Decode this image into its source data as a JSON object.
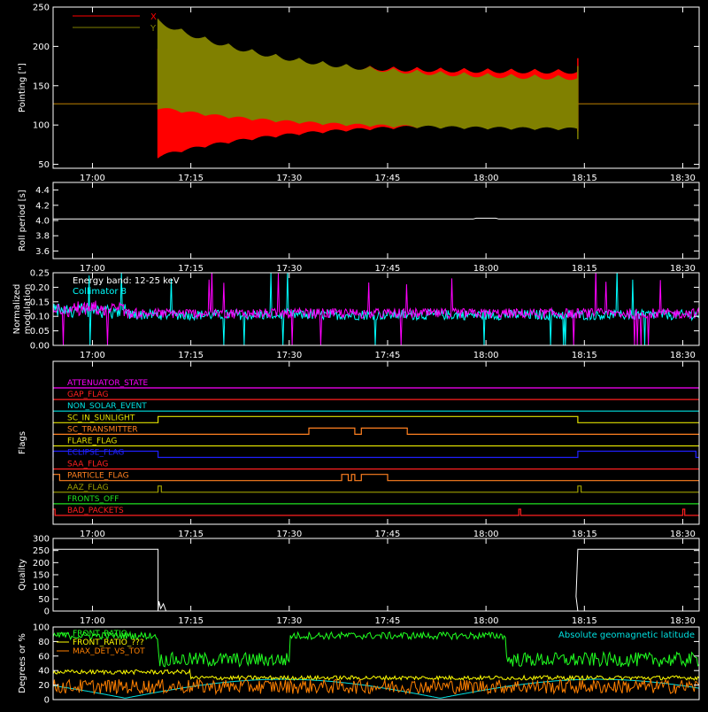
{
  "chart_data": [
    {
      "type": "line",
      "ylabel": "Pointing [\"]",
      "ylim": [
        45,
        250
      ],
      "yticks": [
        50,
        100,
        150,
        200,
        250
      ],
      "xticks": [
        "17:00",
        "17:15",
        "17:30",
        "17:45",
        "18:00",
        "18:15",
        "18:30"
      ],
      "legend_placement": "top-left",
      "series": [
        {
          "name": "X",
          "color": "#ff0000",
          "baseline": 127,
          "active_span": [
            "17:10",
            "18:14"
          ],
          "envelope_start": [
            58,
            197
          ],
          "envelope_end": [
            102,
            170
          ]
        },
        {
          "name": "Y",
          "color": "#808000",
          "baseline": 127,
          "active_span": [
            "17:10",
            "18:14"
          ],
          "envelope_start": [
            120,
            235
          ],
          "envelope_end": [
            92,
            160
          ]
        }
      ]
    },
    {
      "type": "line",
      "ylabel": "Roll period [s]",
      "ylim": [
        3.5,
        4.5
      ],
      "yticks": [
        "3.6",
        "3.8",
        "4.0",
        "4.2",
        "4.4"
      ],
      "xticks": [
        "17:00",
        "17:15",
        "17:30",
        "17:45",
        "18:00",
        "18:15",
        "18:30"
      ],
      "series": [
        {
          "color": "#ffffff",
          "value": 4.02
        }
      ]
    },
    {
      "type": "line",
      "ylabel": "Normalized\nmodulation",
      "ylim": [
        0,
        0.25
      ],
      "yticks": [
        "0.00",
        "0.05",
        "0.10",
        "0.15",
        "0.20",
        "0.25"
      ],
      "xticks": [
        "17:00",
        "17:15",
        "17:30",
        "17:45",
        "18:00",
        "18:15",
        "18:30"
      ],
      "annotations": [
        "Energy band: 12-25 keV",
        "Collimator 8"
      ],
      "series": [
        {
          "color": "#00ffff",
          "mean": 0.105
        },
        {
          "color": "#ff00ff",
          "mean": 0.11
        }
      ]
    },
    {
      "type": "line",
      "ylabel": "Flags",
      "xticks": [
        "17:00",
        "17:15",
        "17:30",
        "17:45",
        "18:00",
        "18:15",
        "18:30"
      ],
      "flags": [
        {
          "name": "ATTENUATOR_STATE",
          "color": "#ff00ff",
          "high": []
        },
        {
          "name": "GAP_FLAG",
          "color": "#ff2020",
          "high": []
        },
        {
          "name": "NON_SOLAR_EVENT",
          "color": "#00e0e0",
          "high": []
        },
        {
          "name": "SC_IN_SUNLIGHT",
          "color": "#e0e000",
          "high": [
            [
              "17:10",
              "18:14"
            ]
          ]
        },
        {
          "name": "SC_TRANSMITTER",
          "color": "#ff8020",
          "high": [
            [
              "17:33",
              "17:40"
            ],
            [
              "17:41",
              "17:48"
            ]
          ]
        },
        {
          "name": "FLARE_FLAG",
          "color": "#e0e000",
          "high": []
        },
        {
          "name": "ECLIPSE_FLAG",
          "color": "#2020ff",
          "high": [
            [
              "16:54",
              "17:10"
            ],
            [
              "18:14",
              "18:32"
            ]
          ]
        },
        {
          "name": "SAA_FLAG",
          "color": "#ff2020",
          "high": []
        },
        {
          "name": "PARTICLE_FLAG",
          "color": "#ff8020",
          "high": [
            [
              "16:54",
              "16:55"
            ],
            [
              "17:38",
              "17:39"
            ],
            [
              "17:39.5",
              "17:40"
            ],
            [
              "17:41",
              "17:45"
            ]
          ]
        },
        {
          "name": "AAZ_FLAG",
          "color": "#a0a000",
          "high": [
            [
              "17:10",
              "17:10.5"
            ],
            [
              "18:14",
              "18:14.5"
            ]
          ]
        },
        {
          "name": "FRONTS_OFF",
          "color": "#20e020",
          "high": []
        },
        {
          "name": "BAD_PACKETS",
          "color": "#ff2020",
          "high": [
            [
              "16:54",
              "16:54.3"
            ],
            [
              "18:05",
              "18:05.3"
            ],
            [
              "18:30",
              "18:30.3"
            ]
          ]
        }
      ]
    },
    {
      "type": "line",
      "ylabel": "Quality",
      "ylim": [
        0,
        300
      ],
      "yticks": [
        0,
        50,
        100,
        150,
        200,
        250,
        300
      ],
      "xticks": [
        "17:00",
        "17:15",
        "17:30",
        "17:45",
        "18:00",
        "18:15",
        "18:30"
      ],
      "series": [
        {
          "color": "#ffffff",
          "high_value": 255,
          "high_spans": [
            [
              "16:54",
              "17:10"
            ],
            [
              "18:14",
              "18:32"
            ]
          ]
        }
      ]
    },
    {
      "type": "line",
      "ylabel": "Degrees or %",
      "ylim": [
        0,
        100
      ],
      "yticks": [
        0,
        20,
        40,
        60,
        80,
        100
      ],
      "series": [
        {
          "name": "FRONT_RATIO",
          "color": "#20ff20"
        },
        {
          "name": "FRONT_RATIO_???",
          "color": "#ffff00"
        },
        {
          "name": "MAX_DET_VS_TOT",
          "color": "#ff8000"
        },
        {
          "name": "Absolute geomagnetic latitude",
          "color": "#00e0e0"
        }
      ]
    }
  ]
}
